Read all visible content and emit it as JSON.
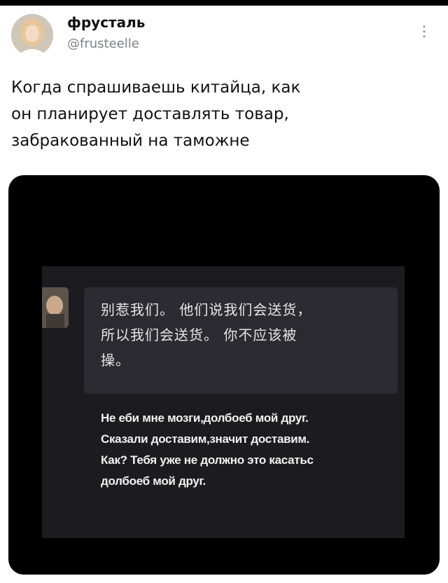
{
  "tweet": {
    "display_name": "фрусталь",
    "handle": "@frusteelle",
    "text_lines": [
      "Когда спрашиваешь китайца, как",
      "он планирует доставлять товар,",
      "забракованный на таможне"
    ]
  },
  "media": {
    "chinese_lines": [
      "别惹我们。 他们说我们会送货，",
      "所以我们会送货。 你不应该被",
      "操。"
    ],
    "translation_lines": [
      "Не еби мне мозги,долбоеб мой друг.",
      "Сказали доставим,значит доставим.",
      "Как? Тебя уже не должно это касатьс",
      "долбоеб мой друг."
    ]
  },
  "icons": {
    "avatar": "user-avatar",
    "more": "more-vertical-icon"
  }
}
